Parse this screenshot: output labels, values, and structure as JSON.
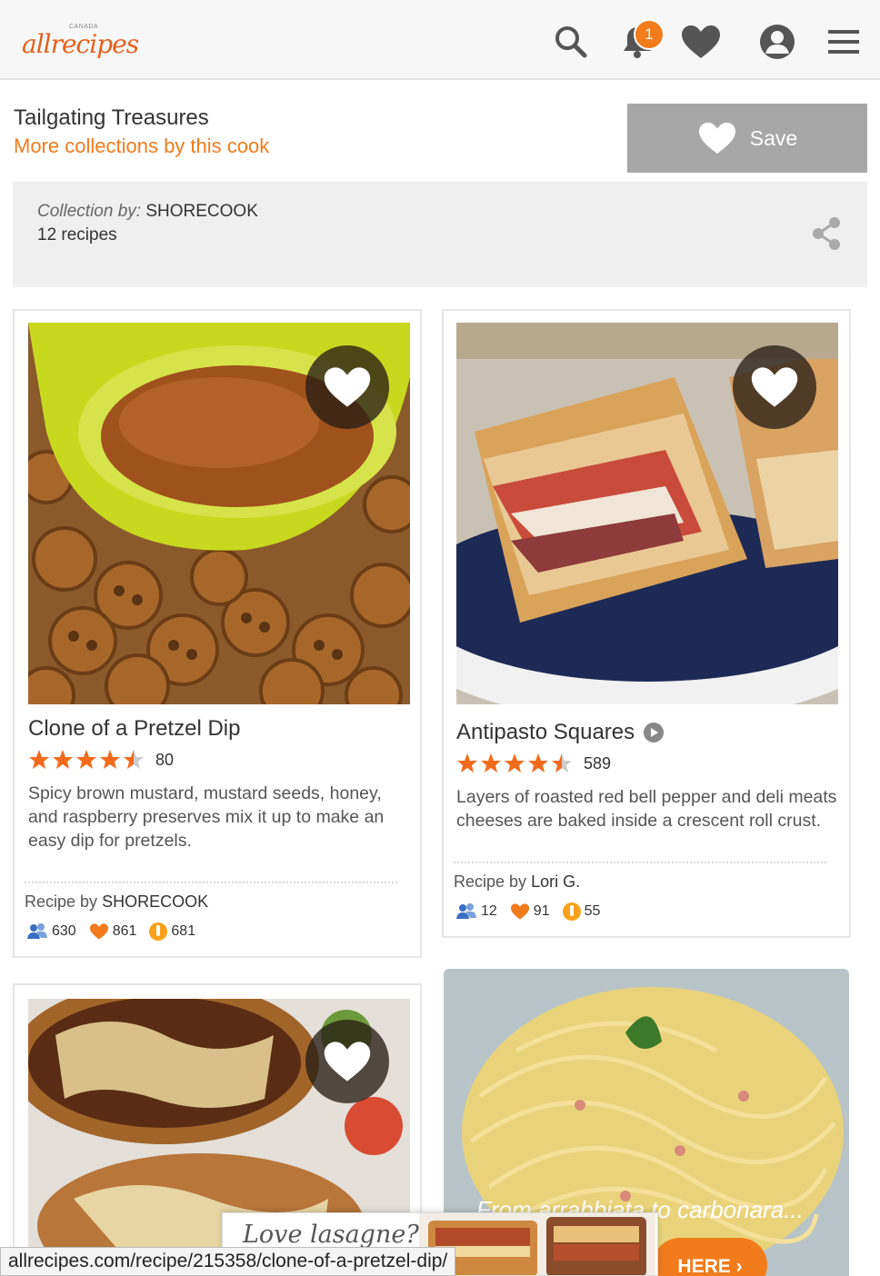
{
  "header": {
    "logo_country": "CANADA",
    "logo_text": "allrecipes",
    "notification_count": "1",
    "icons": [
      "search-icon",
      "bell-icon",
      "heart-icon",
      "user-icon",
      "menu-icon"
    ]
  },
  "collection": {
    "title": "Tailgating Treasures",
    "more_link": "More collections by this cook",
    "save_label": "Save",
    "by_label": "Collection by:",
    "by_name": "SHORECOOK",
    "recipe_count": "12 recipes"
  },
  "recipes": [
    {
      "title": "Clone of a Pretzel Dip",
      "rating": 4.5,
      "review_count": "80",
      "description": "Spicy brown mustard, mustard seeds, honey, and raspberry preserves mix it up to make an easy dip for pretzels.",
      "by_label": "Recipe by",
      "author": "SHORECOOK",
      "followers": "630",
      "favorites": "861",
      "made_it": "681"
    },
    {
      "title": "Antipasto Squares",
      "rating": 4.5,
      "review_count": "589",
      "description": "Layers of roasted red bell pepper and deli meats cheeses are baked inside a crescent roll crust.",
      "by_label": "Recipe by",
      "author": "Lori G.",
      "followers": "12",
      "favorites": "91",
      "made_it": "55"
    }
  ],
  "ad": {
    "tagline": "From arrabbiata to carbonara...",
    "cta": "HERE ›"
  },
  "promo": {
    "text": "Love lasagne?"
  },
  "status_url": "allrecipes.com/recipe/215358/clone-of-a-pretzel-dip/",
  "colors": {
    "brand_orange": "#f27b1c",
    "save_gray": "#a7a7a7",
    "panel_gray": "#efefef"
  }
}
